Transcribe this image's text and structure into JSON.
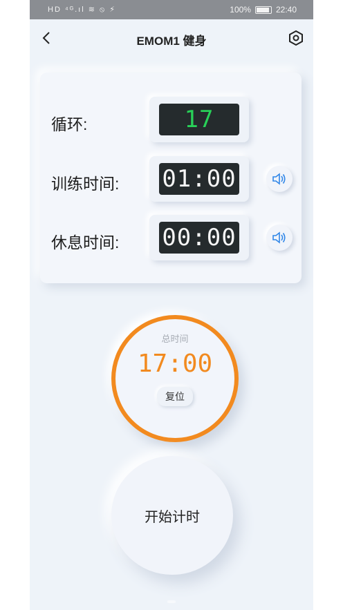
{
  "status_bar": {
    "left_icons": "HD ⁴ᴳ.ıl ≋ ⦸ ⚡",
    "battery_text": "100%",
    "time": "22:40"
  },
  "header": {
    "title": "EMOM1 健身",
    "back_icon": "chevron-left-icon",
    "settings_icon": "hexagon-settings-icon"
  },
  "settings_card": {
    "rounds_label": "循环:",
    "rounds_value": "17",
    "work_label": "训练时间:",
    "work_value": "01:00",
    "rest_label": "休息时间:",
    "rest_value": "00:00"
  },
  "total": {
    "caption": "总时间",
    "value": "17:00",
    "reset_label": "复位"
  },
  "start": {
    "label": "开始计时"
  },
  "colors": {
    "accent_orange": "#f28a1f",
    "display_green": "#28d158",
    "display_white": "#f5f5f5",
    "sound_blue": "#2f86e8",
    "background": "#eef3f9"
  }
}
